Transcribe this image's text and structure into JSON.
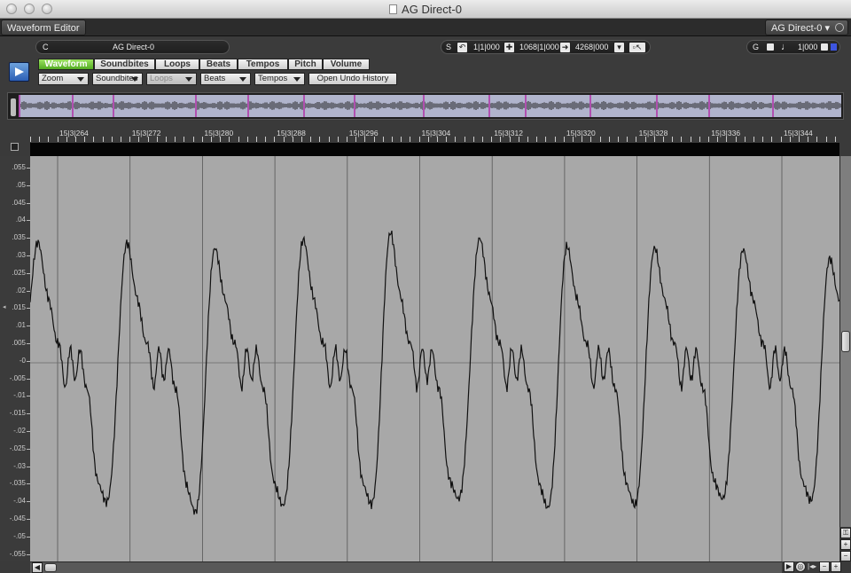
{
  "window": {
    "title": "AG Direct-0"
  },
  "tabs": {
    "active_tab": "Waveform Editor",
    "track_menu": "AG Direct-0 ▾"
  },
  "toolbar": {
    "clip_letter": "C",
    "clip_name": "AG Direct-0",
    "s_label": "S",
    "start_time": "1|1|000",
    "mid_time": "1068|1|000",
    "end_time": "4268|000",
    "g_label": "G",
    "grid_value": "1|000"
  },
  "view_tabs": [
    "Waveform",
    "Soundbites",
    "Loops",
    "Beats",
    "Tempos",
    "Pitch",
    "Volume"
  ],
  "active_view_tab": "Waveform",
  "dropdowns": {
    "zoom": "Zoom",
    "soundbites": "Soundbites",
    "loops": "Loops",
    "beats": "Beats",
    "tempos": "Tempos"
  },
  "undo_button": "Open Undo History",
  "ruler_labels": [
    "15|3|264",
    "15|3|272",
    "15|3|280",
    "15|3|288",
    "15|3|296",
    "15|3|304",
    "15|3|312",
    "15|3|320",
    "15|3|328",
    "15|3|336",
    "15|3|344"
  ],
  "y_ticks": [
    ".055",
    ".05",
    ".045",
    ".04",
    ".035",
    ".03",
    ".025",
    ".02",
    ".015",
    ".01",
    ".005",
    "-0",
    "-.005",
    "-.01",
    "-.015",
    "-.02",
    "-.025",
    "-.03",
    "-.035",
    "-.04",
    "-.045",
    "-.05",
    "-.055"
  ],
  "icons": {
    "play": "play-icon",
    "help": "help-icon"
  },
  "colors": {
    "waveform_bg": "#a8a8a8",
    "active_tab": "#5dbb2a",
    "overview_clip": "#b0b4cc",
    "overview_border": "#b050b0"
  }
}
